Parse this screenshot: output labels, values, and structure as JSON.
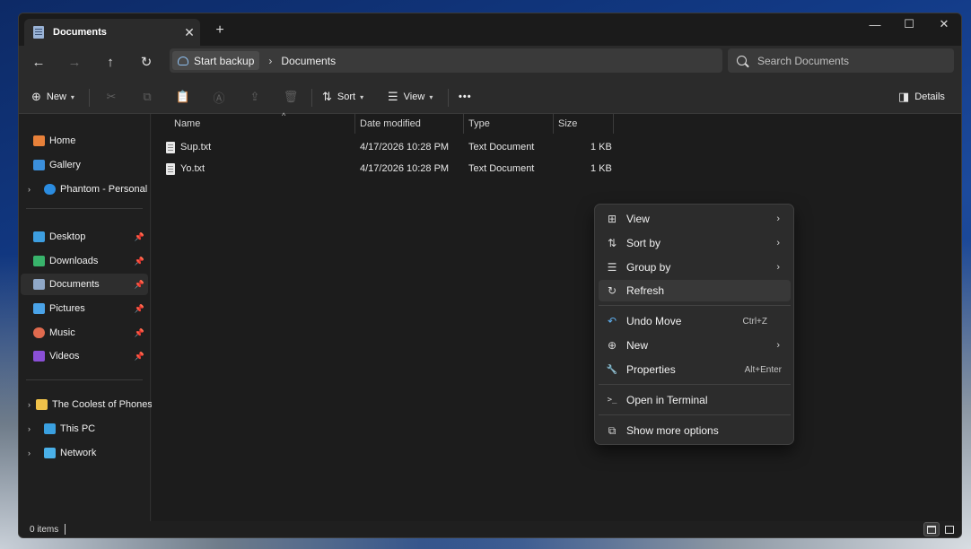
{
  "window": {
    "tab_title": "Documents",
    "tab_close": "✕",
    "new_tab": "+",
    "controls": {
      "minimize": "—",
      "maximize": "☐",
      "close": "✕"
    }
  },
  "address": {
    "back": "←",
    "forward": "→",
    "up": "↑",
    "refresh": "↻",
    "crumbs": [
      "Start backup",
      "Documents"
    ],
    "separator": "›",
    "search_placeholder": "Search Documents"
  },
  "commandbar": {
    "new_label": "New",
    "sort_label": "Sort",
    "view_label": "View",
    "more_label": "•••",
    "details_label": "Details",
    "icons": [
      "cut-icon",
      "copy-icon",
      "paste-icon",
      "rename-icon",
      "share-icon",
      "delete-icon"
    ]
  },
  "sidebar": {
    "top": [
      {
        "label": "Home",
        "icon": "home-icon",
        "color": "#e8813a"
      },
      {
        "label": "Gallery",
        "icon": "gallery-icon",
        "color": "#3b8fdc"
      },
      {
        "label": "Phantom - Personal",
        "icon": "cloud-icon",
        "color": "#2b8ce0",
        "expandable": true
      }
    ],
    "quick_access": [
      {
        "label": "Desktop",
        "icon": "desktop-icon",
        "color": "#3d9ee0",
        "pinned": true
      },
      {
        "label": "Downloads",
        "icon": "download-icon",
        "color": "#38b36b",
        "pinned": true
      },
      {
        "label": "Documents",
        "icon": "documents-icon",
        "color": "#8fa8c8",
        "pinned": true,
        "selected": true
      },
      {
        "label": "Pictures",
        "icon": "pictures-icon",
        "color": "#4aa3e8",
        "pinned": true
      },
      {
        "label": "Music",
        "icon": "music-icon",
        "color": "#e06a4e",
        "pinned": true
      },
      {
        "label": "Videos",
        "icon": "videos-icon",
        "color": "#8a4fd6",
        "pinned": true
      }
    ],
    "bottom": [
      {
        "label": "The Coolest of Phones",
        "icon": "folder-icon",
        "color": "#f0c24a",
        "expandable": true
      },
      {
        "label": "This PC",
        "icon": "pc-icon",
        "color": "#3aa0e0",
        "expandable": true
      },
      {
        "label": "Network",
        "icon": "network-icon",
        "color": "#4ab0e8",
        "expandable": true
      }
    ],
    "expand_glyph": "›",
    "pin_glyph": "📌"
  },
  "files": {
    "columns": [
      "Name",
      "Date modified",
      "Type",
      "Size"
    ],
    "sort_indicator": "^",
    "rows": [
      {
        "name": "Sup.txt",
        "date": "4/17/2026 10:28 PM",
        "type": "Text Document",
        "size": "1 KB"
      },
      {
        "name": "Yo.txt",
        "date": "4/17/2026 10:28 PM",
        "type": "Text Document",
        "size": "1 KB"
      }
    ]
  },
  "status": {
    "item_count": "0 items"
  },
  "context_menu": {
    "items": [
      {
        "label": "View",
        "icon": "view-grid-icon",
        "glyph": "⊞",
        "submenu": true
      },
      {
        "label": "Sort by",
        "icon": "sort-icon",
        "glyph": "⇅",
        "submenu": true
      },
      {
        "label": "Group by",
        "icon": "group-icon",
        "glyph": "☰",
        "submenu": true
      },
      {
        "label": "Refresh",
        "icon": "refresh-icon",
        "glyph": "↻",
        "highlighted": true
      },
      {
        "label": "Undo Move",
        "icon": "undo-icon",
        "glyph": "↶",
        "shortcut": "Ctrl+Z"
      },
      {
        "label": "New",
        "icon": "new-icon",
        "glyph": "⊕",
        "submenu": true
      },
      {
        "label": "Properties",
        "icon": "properties-icon",
        "glyph": "🔧",
        "shortcut": "Alt+Enter"
      },
      {
        "label": "Open in Terminal",
        "icon": "terminal-icon",
        "glyph": ">_"
      },
      {
        "label": "Show more options",
        "icon": "more-options-icon",
        "glyph": "⧉"
      }
    ],
    "submenu_arrow": "›"
  }
}
